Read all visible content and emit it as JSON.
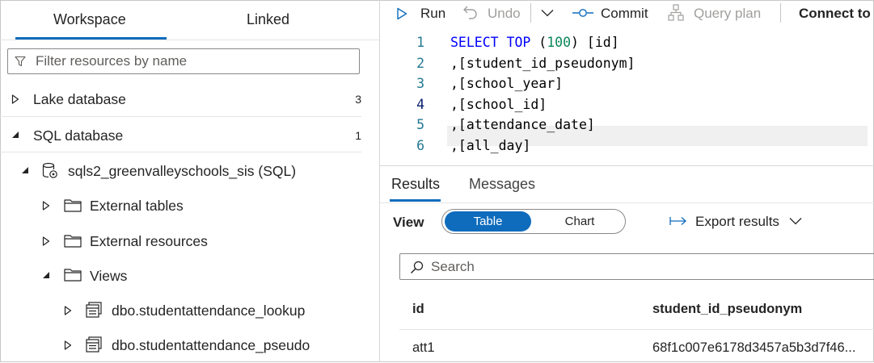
{
  "explorer": {
    "tabs": [
      "Workspace",
      "Linked"
    ],
    "filter_placeholder": "Filter resources by name",
    "sections": [
      {
        "label": "Lake database",
        "count": "3",
        "expanded": false
      },
      {
        "label": "SQL database",
        "count": "1",
        "expanded": true
      }
    ],
    "tree": {
      "database": "sqls2_greenvalleyschools_sis (SQL)",
      "folders": [
        "External tables",
        "External resources",
        "Views"
      ],
      "views": [
        "dbo.studentattendance_lookup",
        "dbo.studentattendance_pseudo"
      ]
    }
  },
  "toolbar": {
    "run": "Run",
    "undo": "Undo",
    "commit": "Commit",
    "query_plan": "Query plan",
    "connect_to": "Connect to"
  },
  "editor": {
    "active_line": 4,
    "lines": [
      {
        "num": "1",
        "tokens": [
          [
            "kw",
            "SELECT TOP "
          ],
          [
            "plain",
            "("
          ],
          [
            "num",
            "100"
          ],
          [
            "plain",
            ") [id]"
          ]
        ]
      },
      {
        "num": "2",
        "tokens": [
          [
            "plain",
            ",[student_id_pseudonym]"
          ]
        ]
      },
      {
        "num": "3",
        "tokens": [
          [
            "plain",
            ",[school_year]"
          ]
        ]
      },
      {
        "num": "4",
        "tokens": [
          [
            "plain",
            ",[school_id]"
          ]
        ]
      },
      {
        "num": "5",
        "tokens": [
          [
            "plain",
            ",[attendance_date]"
          ]
        ]
      },
      {
        "num": "6",
        "tokens": [
          [
            "plain",
            ",[all_day]"
          ]
        ]
      }
    ]
  },
  "results": {
    "tabs": [
      "Results",
      "Messages"
    ],
    "view_label": "View",
    "view_options": [
      "Table",
      "Chart"
    ],
    "export_label": "Export results",
    "search_placeholder": "Search",
    "columns": [
      "id",
      "student_id_pseudonym"
    ],
    "rows": [
      [
        "att1",
        "68f1c007e6178d3457a5b3d7f46..."
      ]
    ]
  },
  "colors": {
    "accent": "#0f6cbd",
    "keyword": "#0000ff",
    "number": "#098658",
    "line_number": "#237893"
  }
}
